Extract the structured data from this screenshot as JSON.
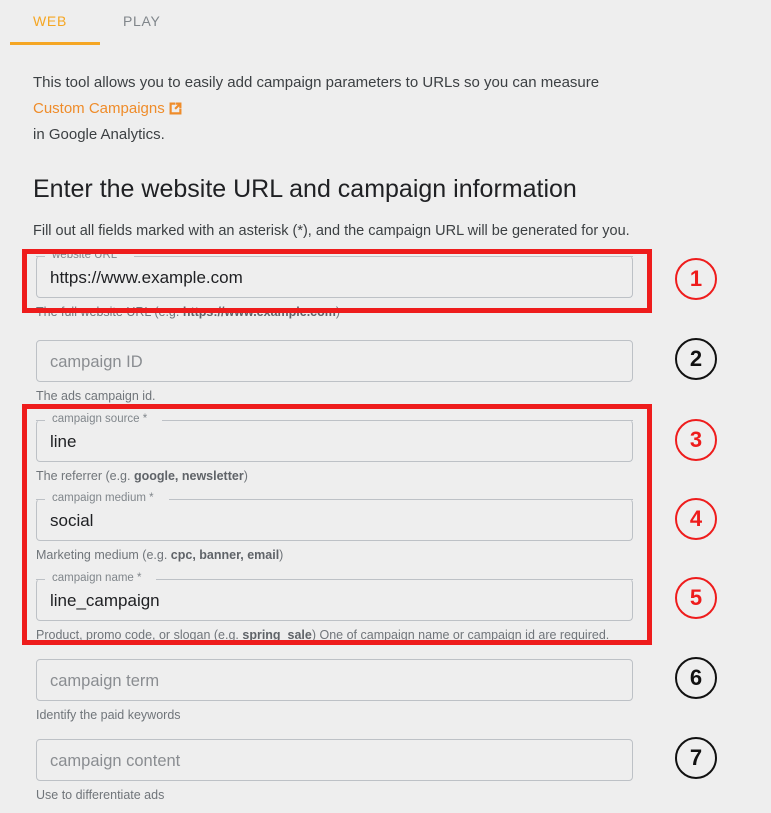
{
  "tabs": [
    {
      "label": "WEB",
      "active": true
    },
    {
      "label": "PLAY",
      "active": false
    }
  ],
  "intro": {
    "line1": "This tool allows you to easily add campaign parameters to URLs so you can measure",
    "link_text": "Custom Campaigns",
    "link_icon": "external-link-icon",
    "line3": "in Google Analytics."
  },
  "page_title": "Enter the website URL and campaign information",
  "subtitle": "Fill out all fields marked with an asterisk (*), and the campaign URL will be generated for you.",
  "fields": [
    {
      "id": "website-url",
      "label": "website URL *",
      "value": "https://www.example.com",
      "placeholder": "",
      "helper_prefix": "The full website URL (e.g. ",
      "helper_bold": "https://www.example.com",
      "helper_suffix": ")",
      "filled": true
    },
    {
      "id": "campaign-id",
      "label": "",
      "value": "",
      "placeholder": "campaign ID",
      "helper_prefix": "The ads campaign id.",
      "helper_bold": "",
      "helper_suffix": "",
      "filled": false
    },
    {
      "id": "campaign-source",
      "label": "campaign source *",
      "value": "line",
      "placeholder": "",
      "helper_prefix": "The referrer (e.g. ",
      "helper_bold": "google, newsletter",
      "helper_suffix": ")",
      "filled": true
    },
    {
      "id": "campaign-medium",
      "label": "campaign medium *",
      "value": "social",
      "placeholder": "",
      "helper_prefix": "Marketing medium (e.g. ",
      "helper_bold": "cpc, banner, email",
      "helper_suffix": ")",
      "filled": true
    },
    {
      "id": "campaign-name",
      "label": "campaign name *",
      "value": "line_campaign",
      "placeholder": "",
      "helper_prefix": "Product, promo code, or slogan (e.g. ",
      "helper_bold": "spring_sale",
      "helper_suffix": ") One of campaign name or campaign id are required.",
      "filled": true
    },
    {
      "id": "campaign-term",
      "label": "",
      "value": "",
      "placeholder": "campaign term",
      "helper_prefix": "Identify the paid keywords",
      "helper_bold": "",
      "helper_suffix": "",
      "filled": false
    },
    {
      "id": "campaign-content",
      "label": "",
      "value": "",
      "placeholder": "campaign content",
      "helper_prefix": "Use to differentiate ads",
      "helper_bold": "",
      "helper_suffix": "",
      "filled": false
    }
  ],
  "badges": [
    {
      "number": "1",
      "color": "#ee1c1c"
    },
    {
      "number": "2",
      "color": "#111111"
    },
    {
      "number": "3",
      "color": "#ee1c1c"
    },
    {
      "number": "4",
      "color": "#ee1c1c"
    },
    {
      "number": "5",
      "color": "#ee1c1c"
    },
    {
      "number": "6",
      "color": "#111111"
    },
    {
      "number": "7",
      "color": "#111111"
    }
  ],
  "annotations": {
    "highlight_color": "#ee1c1c",
    "box1_label": "website-url-highlight",
    "box2_label": "campaign-source-medium-name-highlight"
  },
  "colors": {
    "accent": "#f5a623",
    "link": "#ef8c2a",
    "background": "#eeeeee",
    "field_border": "#bdc1c6"
  }
}
